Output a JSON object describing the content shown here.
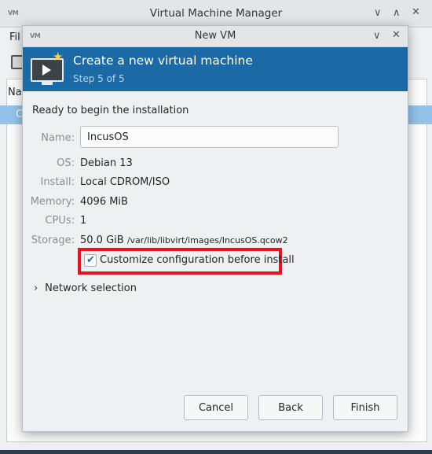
{
  "parent_window": {
    "title": "Virtual Machine Manager",
    "logo": "VM",
    "menu_file": "Fil",
    "column_name": "Na",
    "row_text": "C"
  },
  "dialog": {
    "title": "New VM",
    "logo": "VM",
    "heading": "Create a new virtual machine",
    "step": "Step 5 of 5",
    "ready_text": "Ready to begin the installation",
    "fields": {
      "name_label": "Name:",
      "name_value": "IncusOS",
      "os_label": "OS:",
      "os_value": "Debian 13",
      "install_label": "Install:",
      "install_value": "Local CDROM/ISO",
      "memory_label": "Memory:",
      "memory_value": "4096 MiB",
      "cpus_label": "CPUs:",
      "cpus_value": "1",
      "storage_label": "Storage:",
      "storage_size": "50.0 GiB",
      "storage_path": "/var/lib/libvirt/images/IncusOS.qcow2"
    },
    "customize_label": "Customize configuration before install",
    "customize_checked": true,
    "network_label": "Network selection",
    "buttons": {
      "cancel": "Cancel",
      "back": "Back",
      "finish": "Finish"
    }
  },
  "colors": {
    "banner": "#1b6aa6",
    "highlight": "#e8141b"
  }
}
